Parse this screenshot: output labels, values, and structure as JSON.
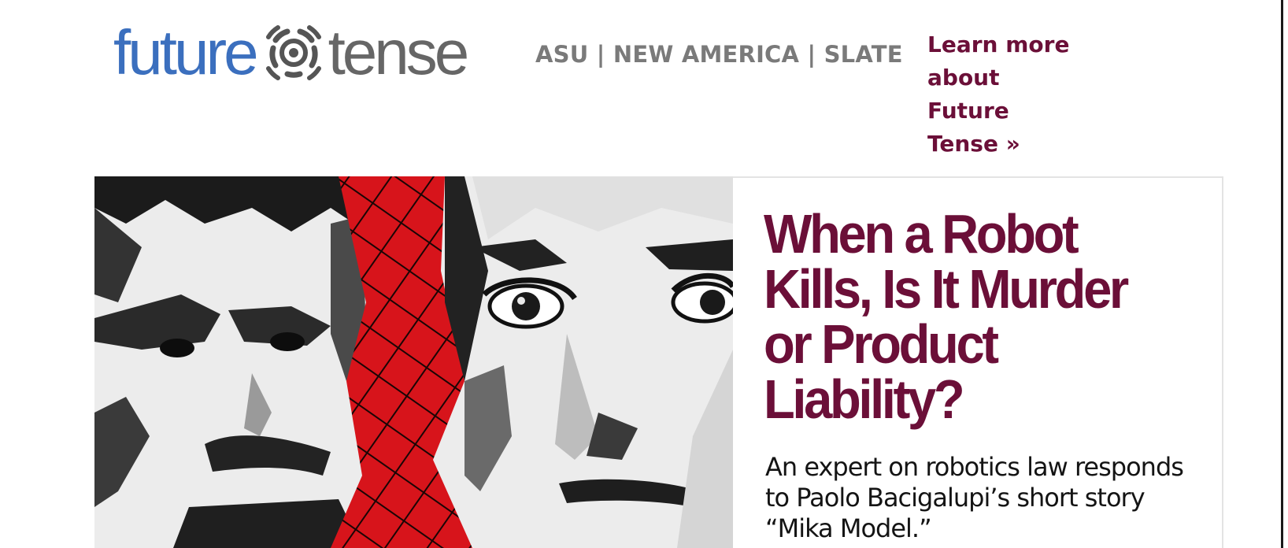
{
  "header": {
    "logo": {
      "word_left": "future",
      "word_right": "tense",
      "mark_icon": "target-rings-icon"
    },
    "partners": "ASU | NEW AMERICA | SLATE",
    "learn_more_link": "Learn more about Future Tense »"
  },
  "article": {
    "headline": "When a Robot Kills, Is It Murder or Product Liability?",
    "dek": "An expert on robotics law responds to Paolo Bacigalupi’s short story “Mika Model.”",
    "image": "ink-painting-two-faces"
  },
  "colors": {
    "brand_blue": "#3b6fbe",
    "brand_gray": "#666666",
    "accent_maroon": "#6b0f38",
    "partner_gray": "#7a7a7a",
    "hero_red": "#d7141b"
  }
}
